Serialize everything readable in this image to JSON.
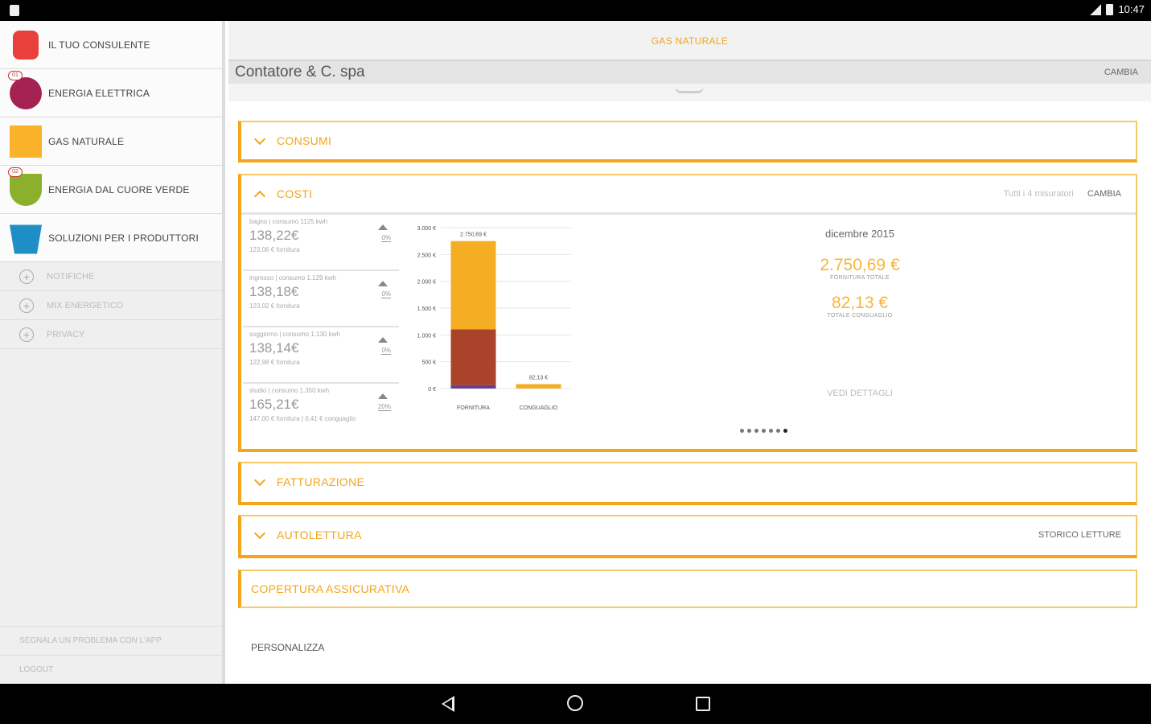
{
  "status_bar": {
    "time": "10:47"
  },
  "sidebar": {
    "items": [
      {
        "label": "IL TUO CONSULENTE",
        "icon": "consultant-icon",
        "badge": ""
      },
      {
        "label": "ENERGIA ELETTRICA",
        "icon": "electric-energy-icon",
        "badge": "01"
      },
      {
        "label": "GAS NATURALE",
        "icon": "natural-gas-icon",
        "badge": ""
      },
      {
        "label": "ENERGIA DAL CUORE VERDE",
        "icon": "green-energy-icon",
        "badge": "02"
      },
      {
        "label": "SOLUZIONI PER I PRODUTTORI",
        "icon": "producer-solutions-icon",
        "badge": ""
      }
    ],
    "sub_items": [
      "NOTIFICHE",
      "MIX ENERGETICO",
      "PRIVACY"
    ],
    "bottom": {
      "report": "SEGNALA UN PROBLEMA CON L'APP",
      "logout": "LOGOUT"
    }
  },
  "header": {
    "title": "GAS NATURALE"
  },
  "company": {
    "name": "Contatore & C. spa",
    "change": "CAMBIA"
  },
  "sections": {
    "consumi": "CONSUMI",
    "costi": {
      "title": "COSTI",
      "filter": "Tutti i 4 misuratori",
      "change": "CAMBIA"
    },
    "fatturazione": "FATTURAZIONE",
    "autolettura": {
      "title": "AUTOLETTURA",
      "link": "STORICO LETTURE"
    },
    "copertura": "COPERTURA ASSICURATIVA"
  },
  "meters": [
    {
      "line1": "bagno | consumo 1125 kwh",
      "amount": "138,22€",
      "line3": "123,06 € fornitura",
      "pct": "0%"
    },
    {
      "line1": "ingresso | consumo 1.129 kwh",
      "amount": "138,18€",
      "line3": "123,02 € fornitura",
      "pct": "0%"
    },
    {
      "line1": "soggiorno | consumo 1.130 kwh",
      "amount": "138,14€",
      "line3": "122,98 € fornitura",
      "pct": "0%"
    },
    {
      "line1": "studio | consumo 1.350 kwh",
      "amount": "165,21€",
      "line3": "147,00 € fornitura | 0,41 € conguaglio",
      "pct": "20%"
    }
  ],
  "chart_data": {
    "type": "bar",
    "categories": [
      "FORNITURA",
      "CONGUAGLIO"
    ],
    "series": [
      {
        "values": [
          65,
          0
        ],
        "color": "#6a3d8f"
      },
      {
        "values": [
          1040,
          0
        ],
        "color": "#a9442a"
      },
      {
        "values": [
          1645,
          82.13
        ],
        "color": "#f5ae23"
      }
    ],
    "bar_labels": [
      "2.750,69 €",
      "82,13 €"
    ],
    "yticks": [
      "0 €",
      "500 €",
      "1.000 €",
      "1.500 €",
      "2.000 €",
      "2.500 €",
      "3.000 €"
    ],
    "ylim": [
      0,
      3000
    ],
    "grid": true
  },
  "detail": {
    "month": "dicembre 2015",
    "total": "2.750,69 €",
    "total_label": "FORNITURA TOTALE",
    "conguaglio": "82,13 €",
    "conguaglio_label": "TOTALE CONGUAGLIO",
    "link": "VEDI DETTAGLI"
  },
  "footer": {
    "customize": "PERSONALIZZA"
  },
  "colors": {
    "accent": "#f3a51c",
    "panel_border": "#f9c867"
  }
}
